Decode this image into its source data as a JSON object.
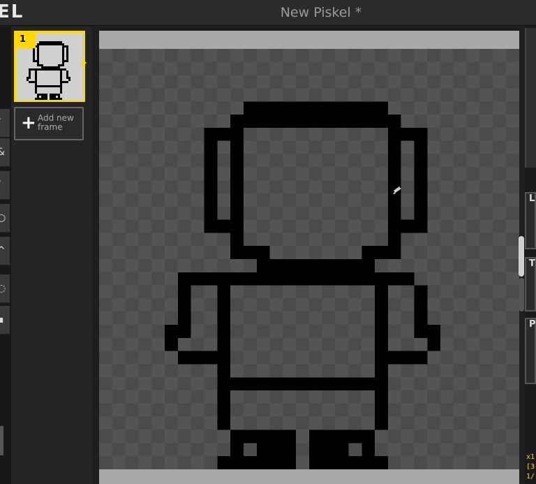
{
  "app": {
    "logo_text": "EL",
    "document_title": "New Piskel *"
  },
  "toolbar": {
    "tools": [
      {
        "icon": "pencil-icon",
        "glyph": "/"
      },
      {
        "icon": "paint-bucket-icon",
        "glyph": "&"
      },
      {
        "icon": "stroke-icon",
        "glyph": "/"
      },
      {
        "icon": "circle-icon",
        "glyph": "○"
      },
      {
        "icon": "lighten-icon",
        "glyph": "^"
      },
      {
        "icon": "lasso-icon",
        "glyph": "◌"
      },
      {
        "icon": "move-icon",
        "glyph": "▪"
      }
    ],
    "primary_color": "#ffffff"
  },
  "frames": {
    "items": [
      {
        "number": "1",
        "selected": true
      }
    ],
    "add_label": "Add new frame",
    "highlight_color": "#ffd700"
  },
  "canvas": {
    "sprite_grid_size": 32,
    "fill_color": "#000000",
    "sprite_rows": [
      "................................",
      "................................",
      "................................",
      "................................",
      "...........11111111111..........",
      "..........1111111111111.........",
      "........111...........111.......",
      "........1.1...........1.1.......",
      "........1.1...........1.1.......",
      "........1.1...........1.1.......",
      "........1.1...........1.1.......",
      "........1.1...........1.1.......",
      "........1.1...........1.1.......",
      "........111...........111.......",
      "..........1...........1.........",
      "..........111.......111.........",
      "............111111111...........",
      "......111111111111111111........",
      "......1..1...........1..1.......",
      "......1..1...........1..1.......",
      "......1..1...........1..1.......",
      ".....11..1...........1..11......",
      ".....1...1...........1...1......",
      "......1111...........1111.......",
      ".........1...........1..........",
      ".........1111111111111..........",
      ".........1...........1..........",
      ".........1...........1..........",
      ".........1...........1..........",
      "..........11111.11111...........",
      "..........1.111.111.1...........",
      ".........111111.111111.........."
    ]
  },
  "right_panel": {
    "tabs": [
      "L",
      "T",
      "P"
    ],
    "status_lines": [
      "x1",
      "[3",
      "1/"
    ]
  }
}
